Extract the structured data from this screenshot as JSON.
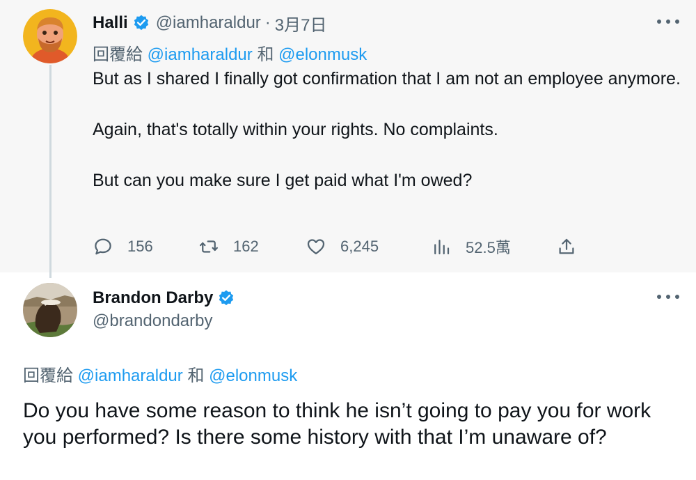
{
  "tweet1": {
    "author_name": "Halli",
    "author_handle": "@iamharaldur",
    "separator": "·",
    "date": "3月7日",
    "reply_prefix": "回覆給",
    "reply_mention_1": "@iamharaldur",
    "reply_joiner": "和",
    "reply_mention_2": "@elonmusk",
    "body_lines": [
      "But as I shared I finally got confirmation that I am not an employee anymore.",
      "Again, that's totally within your rights. No complaints.",
      "But can you make sure I get paid what I'm owed?"
    ],
    "actions": {
      "replies": "156",
      "retweets": "162",
      "likes": "6,245",
      "views": "52.5萬"
    },
    "icons": {
      "verified": "verified-badge-icon",
      "reply": "reply-bubble-icon",
      "retweet": "retweet-icon",
      "like": "heart-icon",
      "views": "bar-chart-icon",
      "share": "share-upload-icon",
      "more": "more-dots-icon"
    }
  },
  "tweet2": {
    "author_name": "Brandon Darby",
    "author_handle": "@brandondarby",
    "reply_prefix": "回覆給",
    "reply_mention_1": "@iamharaldur",
    "reply_joiner": "和",
    "reply_mention_2": "@elonmusk",
    "body": "Do you have some reason to think he isn’t going to pay you for work you performed? Is there some history with that I’m unaware of?"
  },
  "colors": {
    "accent": "#1d9bf0",
    "text": "#0f1419",
    "muted": "#536471",
    "thread_line": "#cfd9de",
    "tweet1_background": "#f7f7f7"
  }
}
